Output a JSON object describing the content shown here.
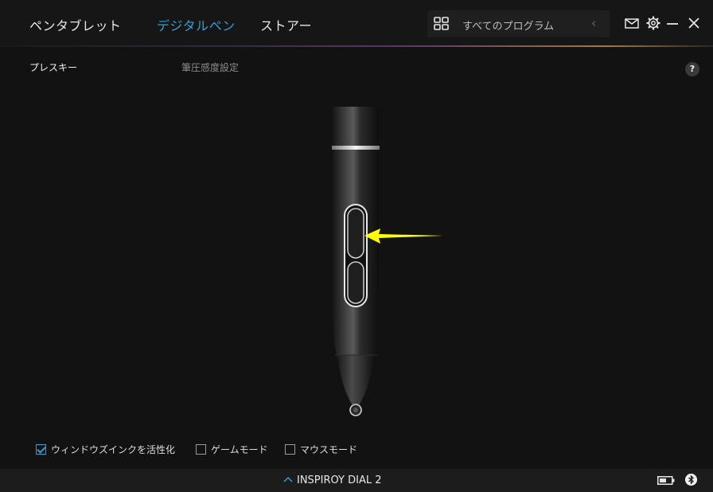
{
  "nav": {
    "tabs": [
      {
        "label": "ペンタブレット",
        "active": false
      },
      {
        "label": "デジタルペン",
        "active": true
      },
      {
        "label": "ストアー",
        "active": false
      }
    ],
    "programs_label": "すべてのプログラム",
    "icons": [
      "grid-icon",
      "chevron-left-icon",
      "mail-icon",
      "settings-icon",
      "minimize-icon",
      "close-icon"
    ]
  },
  "subtabs": {
    "items": [
      {
        "label": "プレスキー",
        "active": true
      },
      {
        "label": "筆圧感度設定",
        "active": false
      }
    ],
    "help_label": "?"
  },
  "options": [
    {
      "label": "ウィンドウズインクを活性化",
      "checked": true
    },
    {
      "label": "ゲームモード",
      "checked": false
    },
    {
      "label": "マウスモード",
      "checked": false
    }
  ],
  "device": {
    "name": "INSPIROY DIAL 2",
    "caret": "^"
  },
  "colors": {
    "accent": "#2ea2d6",
    "arrow": "#ffff00",
    "background": "#121212"
  }
}
